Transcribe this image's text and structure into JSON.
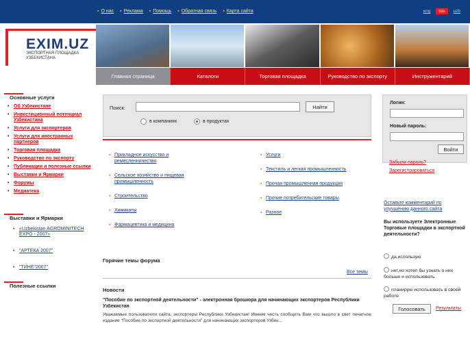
{
  "top_nav": [
    "О нас",
    "Реклама",
    "Помощь",
    "Обратная связь",
    "Карта сайта"
  ],
  "languages": [
    "eng",
    "rus",
    "uzb"
  ],
  "active_language": "rus",
  "logo": {
    "title": "EXIM.UZ",
    "subtitle": "ЭКСПОРТНАЯ ПЛОЩАДКА УЗБЕКИСТАНА"
  },
  "main_nav": [
    "Главная страница",
    "Каталоги",
    "Торговая площадка",
    "Руководство по экспорту",
    "Инструментарий"
  ],
  "sidebar": {
    "services_title": "Основные услуги",
    "services": [
      "Об Узбекистане",
      "Инвестиционный потенциал Узбекистана",
      "Услуги для экспортеров",
      "Услуги для иностранных партнеров",
      "Торговая площадка",
      "Руководство по экспорту",
      "Публикации и полезные ссылки",
      "Выставки и Ярмарки",
      "Форумы",
      "Медиатека"
    ],
    "events_title": "Выставки и Ярмарки",
    "events": [
      "«Uzbekistan AGROMINITECH EXPO - 2007»",
      "\"АРТЕКА 2007\"",
      "\"ТИНЕ\"2007\""
    ],
    "links_title": "Полезные ссылки"
  },
  "search": {
    "label": "Поиск:",
    "button": "Найти",
    "opt_companies": "в компаниях",
    "opt_products": "в продуктах",
    "selected": "products"
  },
  "categories_left": [
    "Прикладное искусство и ремесленничество",
    "Сельское хозяйство и пищевая промышленность",
    "Строительство",
    "Химикаты",
    "Фармацевтика и медицина"
  ],
  "categories_right": [
    "Услуги",
    "Текстиль и легкая промышленность",
    "Прочая промышленная продукция",
    "Прочие потребительские товары",
    "Разное"
  ],
  "forum": {
    "title": "Горячие темы форума",
    "all": "Все темы"
  },
  "news": {
    "title": "Новости",
    "headline": "\"Пособие по экспортной деятельности\" - электронная брошюра для начинающих экспортеров Республики Узбекистан",
    "body": "Уважаемые пользователи сайта, экспортеры Республики Узбекистан! Имеем честь сообщить Вам что вышло в свет печатное издание \"Пособие по экспортной деятельности\" для начинающих экспортеров Узбек..."
  },
  "login": {
    "login_label": "Логин:",
    "password_label": "Новый пароль:",
    "button": "Войти",
    "forgot": "Забыли пароль?",
    "register": "Зарегистрироваться"
  },
  "comment_link": "Оставьте комментарий по улучшению данного сайта",
  "poll": {
    "question": "Вы используете Электронные Торговые площадки в экспортной деятельности?",
    "options": [
      "да,использую",
      "нет,но хотел бы узнать о них больше и использовать",
      "планирую использовать в своей работе"
    ],
    "vote": "Голосовать",
    "results": "Результаты"
  },
  "colors": {
    "nav_red": "#c60e14",
    "top_blue": "#0f3f80",
    "link_blue": "#1a3d8a",
    "accent_red": "#e21e26"
  }
}
